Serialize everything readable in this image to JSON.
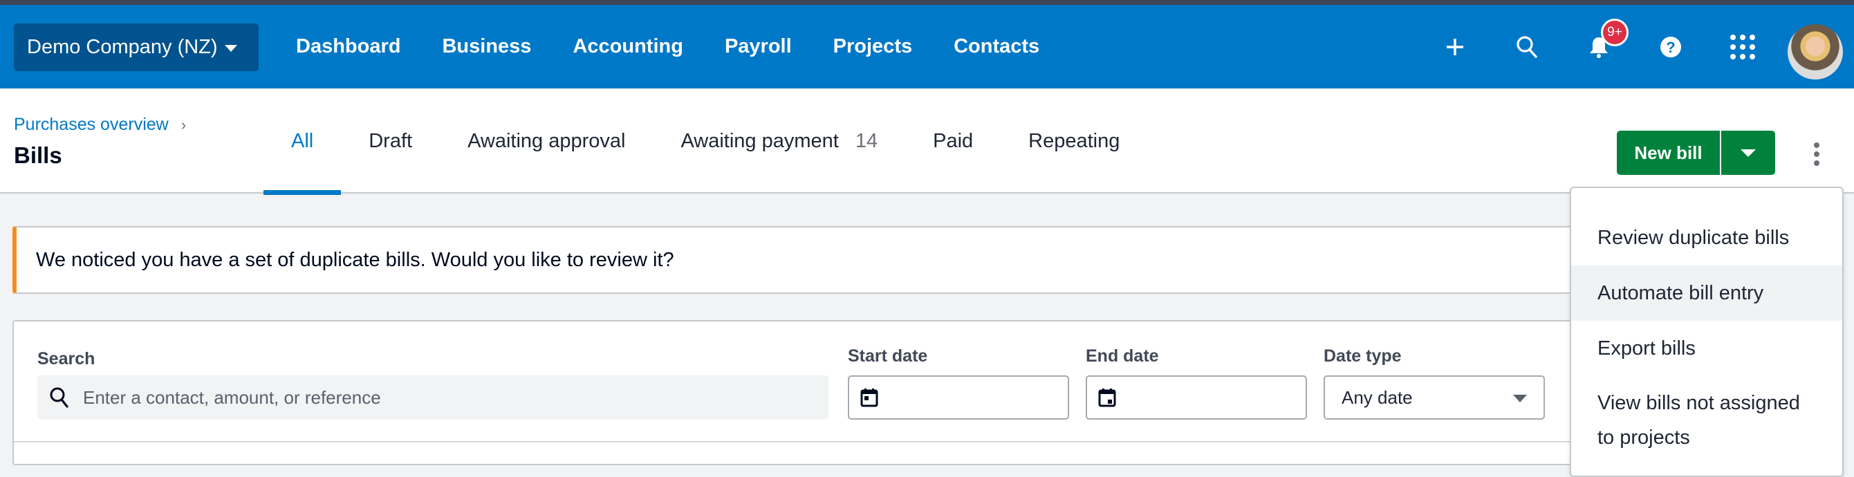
{
  "topnav": {
    "org_name": "Demo Company (NZ)",
    "links": [
      "Dashboard",
      "Business",
      "Accounting",
      "Payroll",
      "Projects",
      "Contacts"
    ],
    "icons": [
      "plus-icon",
      "search-icon",
      "bell-icon",
      "help-icon",
      "apps-grid-icon"
    ],
    "notification_badge": "9+",
    "colors": {
      "nav_bg": "#0078c8",
      "org_bg": "#00538f",
      "badge": "#de2e46"
    }
  },
  "header": {
    "breadcrumb": "Purchases overview",
    "title": "Bills",
    "tabs": [
      {
        "label": "All",
        "active": true
      },
      {
        "label": "Draft"
      },
      {
        "label": "Awaiting approval"
      },
      {
        "label": "Awaiting payment",
        "count": "14"
      },
      {
        "label": "Paid"
      },
      {
        "label": "Repeating"
      }
    ],
    "new_bill_label": "New bill",
    "colors": {
      "primary_btn": "#00823c",
      "active_tab": "#0078c8"
    }
  },
  "banner": {
    "message": "We noticed you have a set of duplicate bills. Would you like to review it?",
    "accent": "#f68b1f"
  },
  "filters": {
    "search_label": "Search",
    "search_placeholder": "Enter a contact, amount, or reference",
    "search_value": "",
    "start_date_label": "Start date",
    "start_date_value": "",
    "end_date_label": "End date",
    "end_date_value": "",
    "date_type_label": "Date type",
    "date_type_value": "Any date"
  },
  "more_menu": {
    "items": [
      "Review duplicate bills",
      "Automate bill entry",
      "Export bills",
      "View bills not assigned to projects"
    ],
    "hovered_index": 1
  }
}
